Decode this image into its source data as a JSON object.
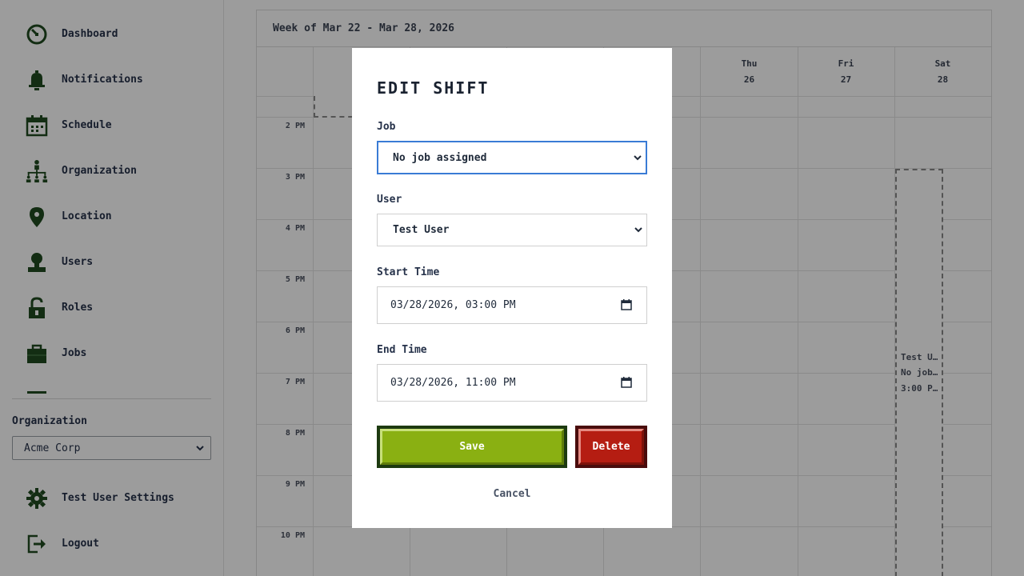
{
  "sidebar": {
    "nav": [
      {
        "label": "Dashboard",
        "icon": "dashboard-gauge-icon"
      },
      {
        "label": "Notifications",
        "icon": "bell-icon"
      },
      {
        "label": "Schedule",
        "icon": "calendar-icon"
      },
      {
        "label": "Organization",
        "icon": "org-chart-icon"
      },
      {
        "label": "Location",
        "icon": "map-pin-icon"
      },
      {
        "label": "Users",
        "icon": "user-icon"
      },
      {
        "label": "Roles",
        "icon": "unlocked-padlock-icon"
      },
      {
        "label": "Jobs",
        "icon": "briefcase-icon"
      }
    ],
    "org_label": "Organization",
    "org_value": "Acme Corp",
    "settings_label": "Test User Settings",
    "logout_label": "Logout"
  },
  "calendar": {
    "week_title": "Week of Mar 22 - Mar 28, 2026",
    "days": [
      {
        "name": "Thu",
        "num": "26"
      },
      {
        "name": "Fri",
        "num": "27"
      },
      {
        "name": "Sat",
        "num": "28"
      }
    ],
    "times": [
      "2 PM",
      "3 PM",
      "4 PM",
      "5 PM",
      "6 PM",
      "7 PM",
      "8 PM",
      "9 PM",
      "10 PM"
    ],
    "shift": {
      "user": "Test U…",
      "job": "No job…",
      "time": "3:00 P…"
    }
  },
  "modal": {
    "title": "Edit Shift",
    "job_label": "Job",
    "job_value": "No job assigned",
    "user_label": "User",
    "user_value": "Test User",
    "start_label": "Start Time",
    "start_value": "03/28/2026, 03:00 PM",
    "end_label": "End Time",
    "end_value": "03/28/2026, 11:00 PM",
    "save_label": "Save",
    "delete_label": "Delete",
    "cancel_label": "Cancel"
  },
  "colors": {
    "icon_green": "#1f4a1f",
    "save_green": "#8ab012",
    "delete_red": "#b51d12",
    "focus_blue": "#3a7bd5"
  }
}
